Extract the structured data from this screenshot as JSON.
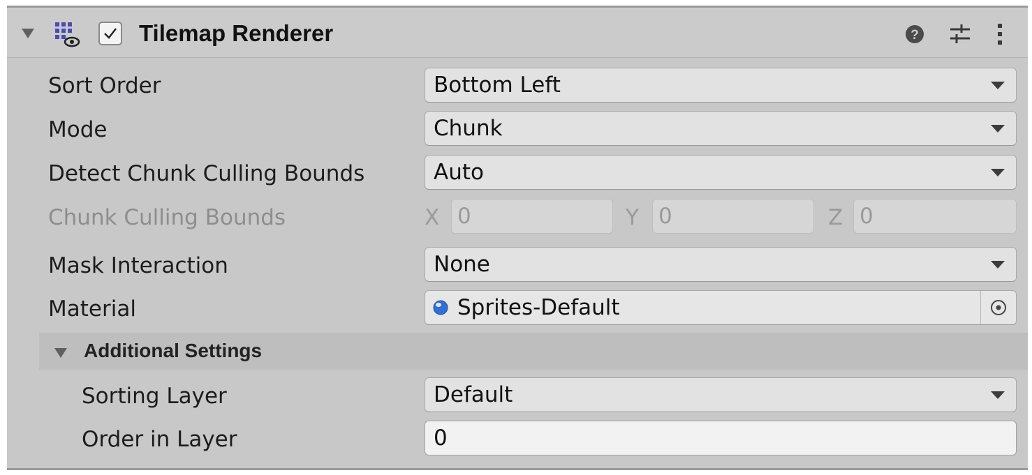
{
  "component": {
    "title": "Tilemap Renderer",
    "enabled": true
  },
  "fields": {
    "sort_order": {
      "label": "Sort Order",
      "value": "Bottom Left"
    },
    "mode": {
      "label": "Mode",
      "value": "Chunk"
    },
    "detect_chunk_culling_bounds": {
      "label": "Detect Chunk Culling Bounds",
      "value": "Auto"
    },
    "chunk_culling_bounds": {
      "label": "Chunk Culling Bounds",
      "x_label": "X",
      "x_value": "0",
      "y_label": "Y",
      "y_value": "0",
      "z_label": "Z",
      "z_value": "0"
    },
    "mask_interaction": {
      "label": "Mask Interaction",
      "value": "None"
    },
    "material": {
      "label": "Material",
      "value": "Sprites-Default"
    }
  },
  "additional_settings": {
    "title": "Additional Settings",
    "sorting_layer": {
      "label": "Sorting Layer",
      "value": "Default"
    },
    "order_in_layer": {
      "label": "Order in Layer",
      "value": "0"
    }
  },
  "icons": {
    "component": "tilemap-renderer-icon",
    "help": "help-icon",
    "presets": "presets-icon",
    "more": "more-icon",
    "material": "material-sphere-icon",
    "object_picker": "object-picker-icon"
  },
  "colors": {
    "panel_bg": "#c8c8c8",
    "field_bg": "#e2e2e2",
    "material_icon": "#2f6fd6"
  }
}
